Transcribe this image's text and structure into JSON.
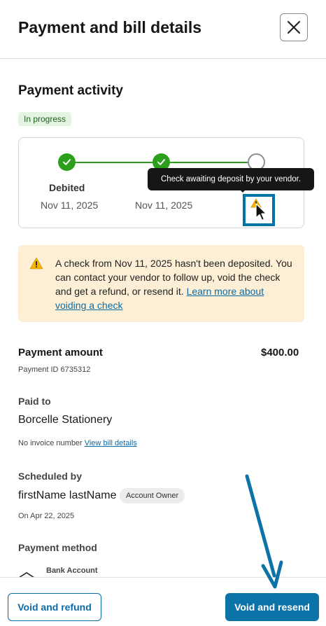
{
  "header": {
    "title": "Payment and bill details",
    "close_icon": "close-icon"
  },
  "activity": {
    "title": "Payment activity",
    "status": "In progress",
    "steps": [
      {
        "label": "Debited",
        "date": "Nov 11, 2025",
        "state": "done"
      },
      {
        "label": "",
        "date": "Nov 11, 2025",
        "state": "done"
      },
      {
        "label": "",
        "date": "",
        "state": "pending"
      }
    ],
    "tooltip": "Check awaiting deposit by your vendor."
  },
  "warning": {
    "text": "A check from Nov 11, 2025 hasn't been deposited. You can contact your vendor to follow up, void the check and get a refund, or resend it.",
    "link": "Learn more about voiding a check"
  },
  "payment": {
    "amount_label": "Payment amount",
    "amount": "$400.00",
    "id_text": "Payment ID 6735312"
  },
  "paid_to": {
    "label": "Paid to",
    "vendor": "Borcelle Stationery",
    "invoice_text": "No invoice number",
    "bill_link": "View bill details"
  },
  "scheduled": {
    "label": "Scheduled by",
    "name": "firstName lastName",
    "badge": "Account Owner",
    "date": "On Apr 22, 2025"
  },
  "method": {
    "label": "Payment method",
    "account": "Bank Account"
  },
  "footer": {
    "void_refund": "Void and refund",
    "void_resend": "Void and resend"
  },
  "colors": {
    "accent": "#0b73a8",
    "success": "#2ca01c",
    "warning_bg": "#fcefd5"
  }
}
